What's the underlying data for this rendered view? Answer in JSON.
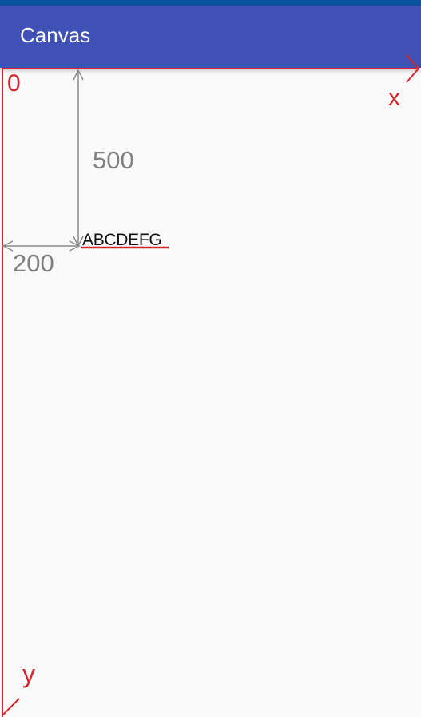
{
  "status_bar": {
    "color": "#0b53a0"
  },
  "app_bar": {
    "title": "Canvas",
    "color": "#3f51b5"
  },
  "axes": {
    "color": "#d8232a",
    "origin_label": "0",
    "x_label": "x",
    "y_label": "y"
  },
  "dimensions": {
    "color": "#808080",
    "vertical_offset_label": "500",
    "horizontal_offset_label": "200"
  },
  "drawn_text": {
    "value": "ABCDEFG",
    "baseline_color": "#d8232a"
  },
  "background": "#fafafa"
}
